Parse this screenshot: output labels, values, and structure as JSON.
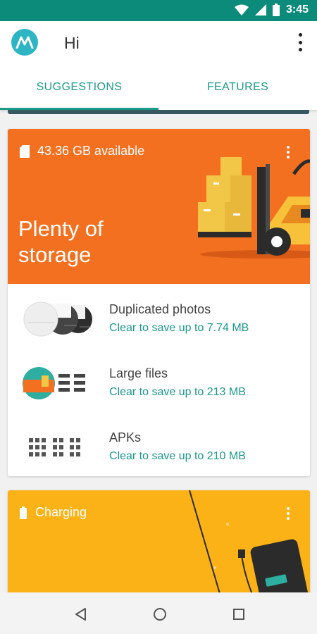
{
  "status_bar": {
    "time": "3:45",
    "icons": [
      "wifi-icon",
      "signal-icon",
      "battery-icon"
    ]
  },
  "app_bar": {
    "title": "Hi",
    "logo": "motorola-logo",
    "menu_icon": "overflow-menu-icon"
  },
  "tabs": [
    {
      "label": "SUGGESTIONS",
      "selected": true
    },
    {
      "label": "FEATURES",
      "selected": false
    }
  ],
  "storage_card": {
    "available": "43.36 GB available",
    "headline_line1": "Plenty of",
    "headline_line2": "storage",
    "accent": "#f37021",
    "items": [
      {
        "name": "Duplicated photos",
        "detail": "Clear to save up to 7.74 MB",
        "icon": "duplicate-photos-icon"
      },
      {
        "name": "Large files",
        "detail": "Clear to save up to 213 MB",
        "icon": "large-files-icon"
      },
      {
        "name": "APKs",
        "detail": "Clear to save up to 210 MB",
        "icon": "apk-files-icon"
      }
    ]
  },
  "charging_card": {
    "label": "Charging",
    "accent": "#fbb216"
  },
  "colors": {
    "status_bar": "#0c8a7a",
    "teal_accent": "#1b9a8a"
  },
  "nav_bar": {
    "buttons": [
      "back-icon",
      "home-icon",
      "recents-icon"
    ]
  }
}
